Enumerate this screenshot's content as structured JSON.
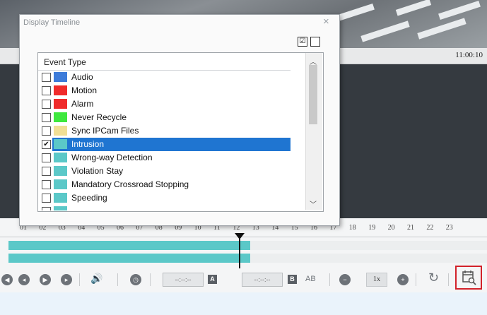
{
  "dialog": {
    "title": "Display Timeline",
    "close_glyph": "×",
    "select_all_glyph": "☑",
    "list_header": "Event Type",
    "items": [
      {
        "label": "Audio",
        "color": "#3d7bd9",
        "checked": false,
        "selected": false
      },
      {
        "label": "Motion",
        "color": "#f02b2b",
        "checked": false,
        "selected": false
      },
      {
        "label": "Alarm",
        "color": "#f02b2b",
        "checked": false,
        "selected": false
      },
      {
        "label": "Never Recycle",
        "color": "#3ee83e",
        "checked": false,
        "selected": false
      },
      {
        "label": "Sync IPCam Files",
        "color": "#f0df95",
        "checked": false,
        "selected": false
      },
      {
        "label": "Intrusion",
        "color": "#5bc8c8",
        "checked": true,
        "selected": true
      },
      {
        "label": "Wrong-way Detection",
        "color": "#5bc8c8",
        "checked": false,
        "selected": false
      },
      {
        "label": "Violation Stay",
        "color": "#5bc8c8",
        "checked": false,
        "selected": false
      },
      {
        "label": "Mandatory Crossroad Stopping",
        "color": "#5bc8c8",
        "checked": false,
        "selected": false
      },
      {
        "label": "Speeding",
        "color": "#5bc8c8",
        "checked": false,
        "selected": false
      }
    ]
  },
  "player": {
    "timestamp": "11:00:10",
    "hours": [
      "01",
      "02",
      "03",
      "04",
      "05",
      "06",
      "07",
      "08",
      "09",
      "10",
      "11",
      "12",
      "13",
      "14",
      "15",
      "16",
      "17",
      "18",
      "19",
      "20",
      "21",
      "22",
      "23"
    ],
    "time_field_a": "--:--:--",
    "time_field_b": "--:--:--",
    "tag_a": "A",
    "tag_b": "B",
    "ab_label": "AB",
    "speed": "1x",
    "track_color": "#5bc8c8"
  }
}
